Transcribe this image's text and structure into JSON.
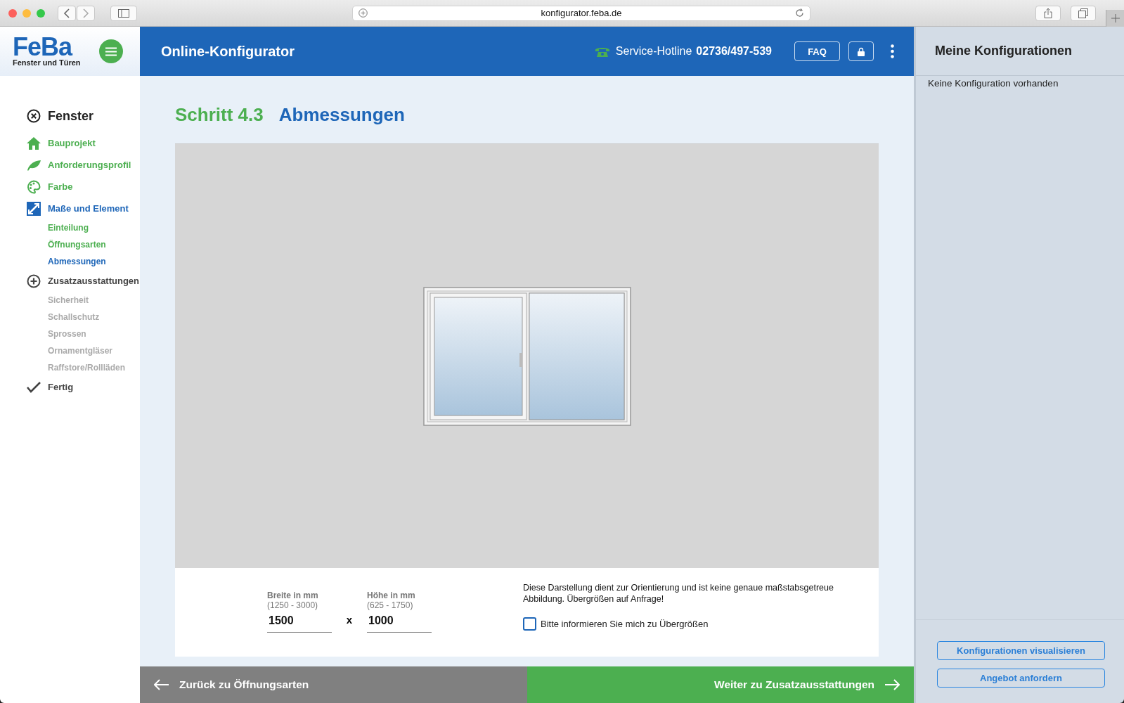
{
  "browser": {
    "url": "konfigurator.feba.de"
  },
  "logo": {
    "name": "FeBa",
    "tagline": "Fenster und Türen"
  },
  "header": {
    "title": "Online-Konfigurator",
    "hotline_label": "Service-Hotline",
    "hotline_number": "02736/497-539",
    "faq": "FAQ"
  },
  "sidebar": {
    "items": [
      {
        "kind": "section",
        "label": "Fenster",
        "done": false,
        "selected": false
      },
      {
        "kind": "step",
        "label": "Bauprojekt",
        "done": true,
        "selected": false
      },
      {
        "kind": "step",
        "label": "Anforderungsprofil",
        "done": true,
        "selected": false
      },
      {
        "kind": "step",
        "label": "Farbe",
        "done": true,
        "selected": false
      },
      {
        "kind": "step",
        "label": "Maße und Element",
        "done": false,
        "selected": true
      },
      {
        "kind": "substep",
        "label": "Einteilung",
        "done": true,
        "selected": false
      },
      {
        "kind": "substep",
        "label": "Öffnungsarten",
        "done": true,
        "selected": false
      },
      {
        "kind": "substep",
        "label": "Abmessungen",
        "done": false,
        "selected": true
      },
      {
        "kind": "step",
        "label": "Zusatzausstattungen",
        "done": false,
        "selected": false
      },
      {
        "kind": "substep",
        "label": "Sicherheit",
        "done": false,
        "selected": false
      },
      {
        "kind": "substep",
        "label": "Schallschutz",
        "done": false,
        "selected": false
      },
      {
        "kind": "substep",
        "label": "Sprossen",
        "done": false,
        "selected": false
      },
      {
        "kind": "substep",
        "label": "Ornamentgläser",
        "done": false,
        "selected": false
      },
      {
        "kind": "substep",
        "label": "Raffstore/Rollläden",
        "done": false,
        "selected": false
      },
      {
        "kind": "step",
        "label": "Fertig",
        "done": false,
        "selected": false
      }
    ]
  },
  "step": {
    "number": "Schritt 4.3",
    "title": "Abmessungen"
  },
  "dimensions": {
    "width": {
      "label": "Breite in mm",
      "range": "(1250 - 3000)",
      "value": "1500"
    },
    "separator": "x",
    "height": {
      "label": "Höhe in mm",
      "range": "(625 - 1750)",
      "value": "1000"
    }
  },
  "notice": "Diese Darstellung dient zur Orientierung und ist keine genaue maßstabsgetreue Abbildung. Übergrößen auf Anfrage!",
  "oversize_checkbox": {
    "label": "Bitte informieren Sie mich zu Übergrößen",
    "checked": false
  },
  "nav": {
    "back": "Zurück zu Öffnungsarten",
    "next": "Weiter zu Zusatzausstattungen"
  },
  "my_configs": {
    "title": "Meine Konfigurationen",
    "empty": "Keine Konfiguration vorhanden",
    "buttons": [
      "Konfigurationen visualisieren",
      "Angebot anfordern"
    ]
  }
}
